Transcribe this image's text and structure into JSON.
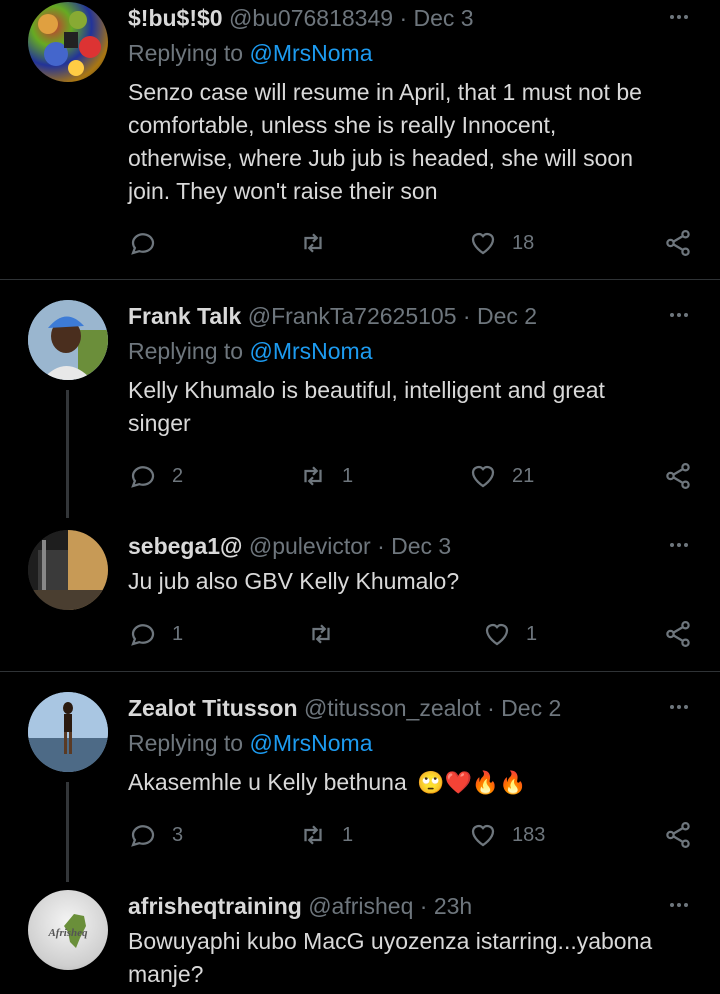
{
  "tweets": [
    {
      "name": "$!bu$!$0",
      "handle": "@bu076818349",
      "date": "Dec 3",
      "replying_prefix": "Replying to",
      "replying_to": "@MrsNoma",
      "text_lines": [
        "Senzo case will resume in April, that 1 must not be",
        "comfortable, unless she is really Innocent,",
        "otherwise, where Jub jub is headed, she will soon",
        "join. They won't raise their son"
      ],
      "replies": "",
      "retweets": "",
      "likes": "18"
    },
    {
      "name": "Frank Talk",
      "handle": "@FrankTa72625105",
      "date": "Dec 2",
      "replying_prefix": "Replying to",
      "replying_to": "@MrsNoma",
      "text_lines": [
        "Kelly Khumalo is beautiful, intelligent and great",
        "singer"
      ],
      "replies": "2",
      "retweets": "1",
      "likes": "21"
    },
    {
      "name": "sebega1@",
      "handle": "@pulevictor",
      "date": "Dec 3",
      "text_lines": [
        "Ju jub also GBV Kelly Khumalo?"
      ],
      "replies": "1",
      "retweets": "",
      "likes": "1"
    },
    {
      "name": "Zealot Titusson",
      "handle": "@titusson_zealot",
      "date": "Dec 2",
      "replying_prefix": "Replying to",
      "replying_to": "@MrsNoma",
      "text_lines": [
        "Akasemhle u Kelly bethuna"
      ],
      "emojis": "🙄❤️🔥🔥",
      "replies": "3",
      "retweets": "1",
      "likes": "183"
    },
    {
      "name": "afrisheqtraining",
      "handle": "@afrisheq",
      "date": "23h",
      "avatar_logo_text": "Afrisheq",
      "text_lines": [
        "Bowuyaphi kubo MacG uyozenza istarring...yabona",
        "manje?"
      ]
    }
  ],
  "separator_dot": "·",
  "icons": {
    "reply": "reply-icon",
    "retweet": "retweet-icon",
    "like": "heart-icon",
    "share": "share-icon",
    "more": "more-icon"
  },
  "colors": {
    "background": "#000000",
    "text": "#d9d9d9",
    "muted": "#6e767d",
    "accent": "#1d9bf0"
  }
}
